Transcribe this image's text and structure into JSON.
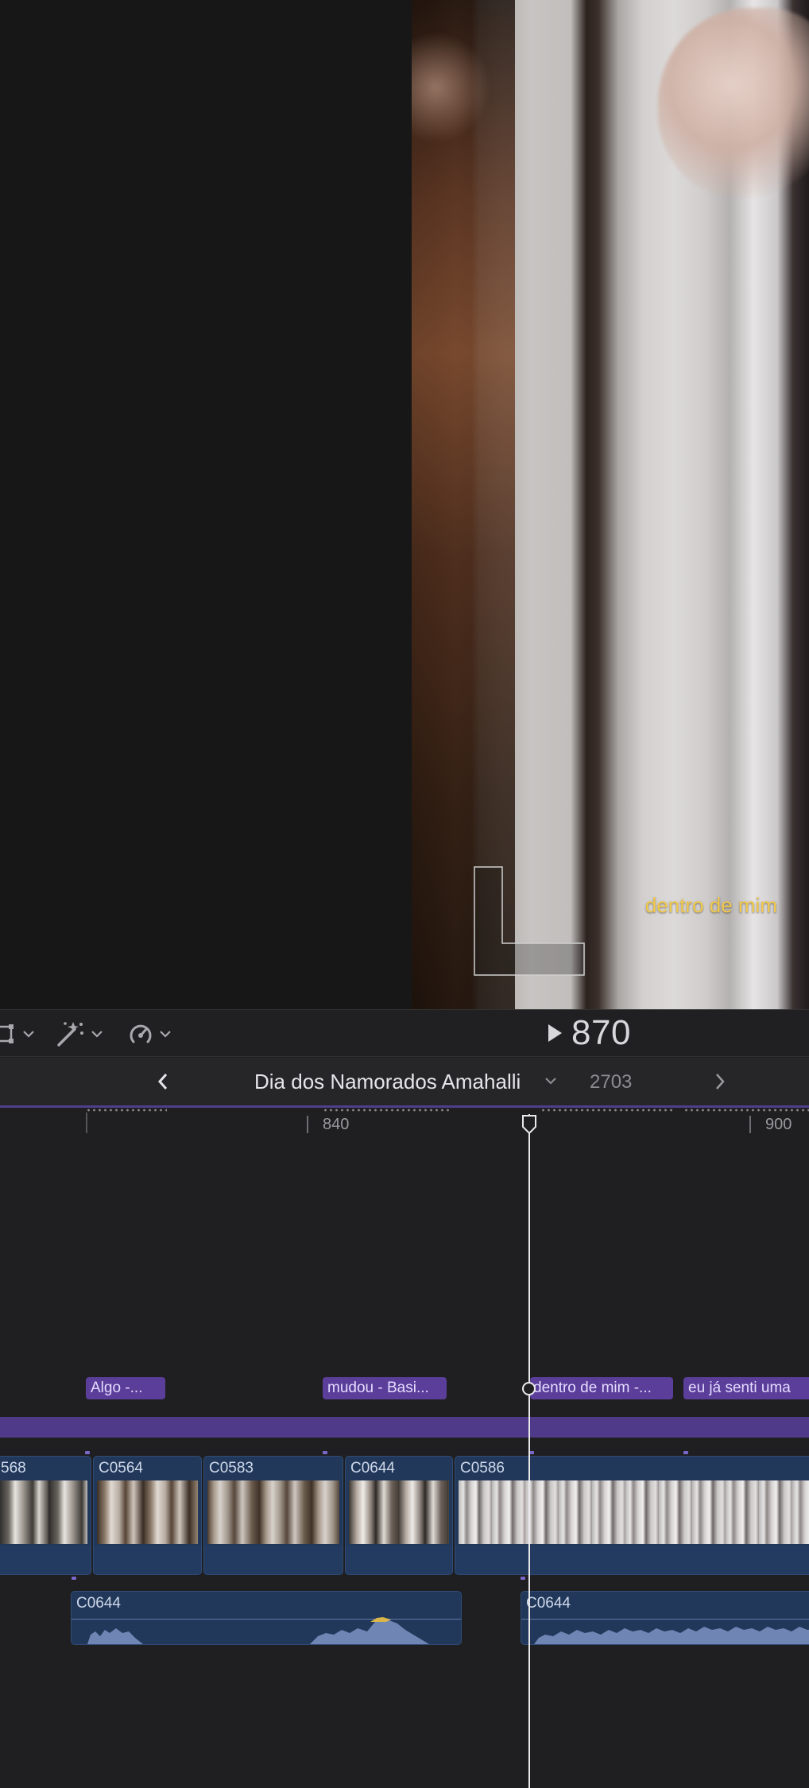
{
  "viewer": {
    "caption": "dentro de mim"
  },
  "toolbar": {
    "tools": [
      {
        "name": "transform-tool",
        "icon": "crop-icon"
      },
      {
        "name": "enhance-tool",
        "icon": "magic-wand-icon"
      },
      {
        "name": "speed-tool",
        "icon": "speedometer-icon"
      }
    ],
    "timecode": "870"
  },
  "project": {
    "title": "Dia dos Namorados Amahalli",
    "duration": "2703"
  },
  "ruler": {
    "labels": [
      "840",
      "900"
    ]
  },
  "markers": [
    {
      "label": "Algo -..."
    },
    {
      "label": "mudou - Basi..."
    },
    {
      "label": "dentro de mim -..."
    },
    {
      "label": "eu já senti uma"
    }
  ],
  "clips": [
    {
      "name": "568"
    },
    {
      "name": "C0564"
    },
    {
      "name": "C0583"
    },
    {
      "name": "C0644"
    },
    {
      "name": "C0586"
    }
  ],
  "audio_clips": [
    {
      "name": "C0644"
    },
    {
      "name": "C0644"
    }
  ],
  "colors": {
    "marker": "#5b3e9a",
    "title_bar": "#4e3a88",
    "clip": "#22385a",
    "caption": "#f2c94c"
  }
}
